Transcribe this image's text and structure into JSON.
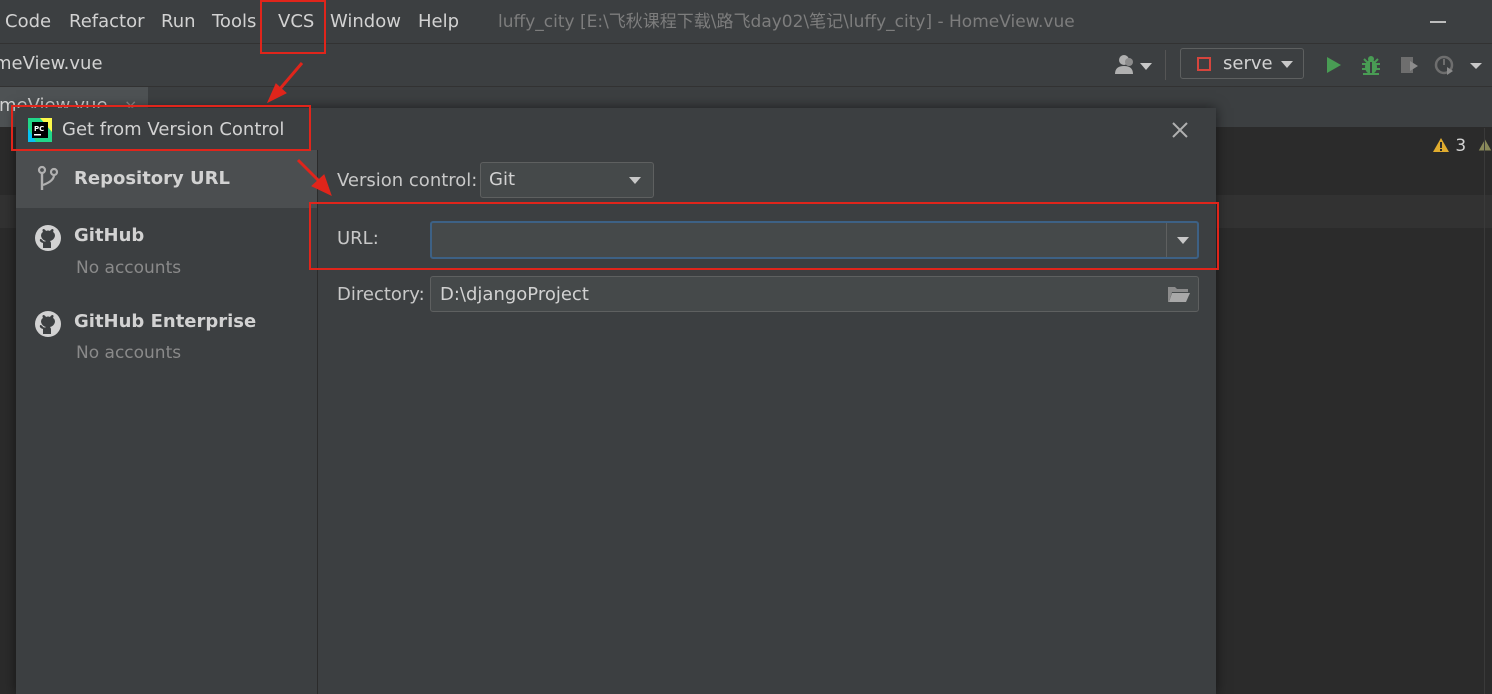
{
  "menubar": {
    "items": [
      "Code",
      "Refactor",
      "Run",
      "Tools",
      "VCS",
      "Window",
      "Help"
    ],
    "window_title": "luffy_city [E:\\飞秋课程下载\\路飞day02\\笔记\\luffy_city] - HomeView.vue"
  },
  "navbar": {
    "breadcrumb_file": "meView.vue",
    "run_config": "serve"
  },
  "tabs": {
    "active_tab": "omeView.vue",
    "close_glyph": "×"
  },
  "editor": {
    "warning_count": "3"
  },
  "dialog": {
    "title": "Get from Version Control",
    "nav_items": [
      {
        "label": "Repository URL",
        "sub": ""
      },
      {
        "label": "GitHub",
        "sub": "No accounts"
      },
      {
        "label": "GitHub Enterprise",
        "sub": "No accounts"
      }
    ],
    "version_control_label": "Version control:",
    "version_control_value": "Git",
    "url_label": "URL:",
    "url_value": "",
    "directory_label": "Directory:",
    "directory_value": "D:\\djangoProject"
  },
  "colors": {
    "annotation_red": "#e0251b",
    "focus_blue": "#3d6185",
    "run_green": "#499c54",
    "warning_yellow": "#e0ac2e"
  },
  "icons": [
    "user-icon",
    "run-icon",
    "debug-icon",
    "coverage-icon",
    "profile-icon",
    "close-icon",
    "folder-icon",
    "branch-icon",
    "github-icon",
    "pycharm-logo",
    "warning-icon"
  ]
}
